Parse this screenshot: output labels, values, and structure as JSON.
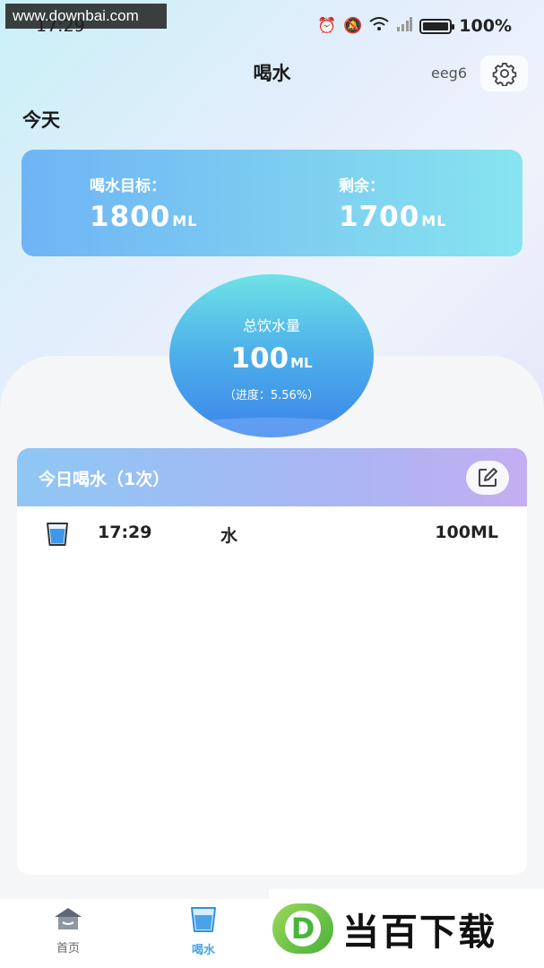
{
  "watermark_top": "www.downbai.com",
  "status_bar": {
    "time": "17:29",
    "battery": "100%"
  },
  "header": {
    "title": "喝水",
    "username": "eeg6"
  },
  "today_label": "今天",
  "target_card": {
    "goal_label": "喝水目标：",
    "goal_value": "1800",
    "remaining_label": "剩余：",
    "remaining_value": "1700",
    "unit": "ML"
  },
  "total_circle": {
    "label": "总饮水量",
    "value": "100",
    "unit": "ML",
    "progress_text": "（进度：5.56%）"
  },
  "records": {
    "title": "今日喝水（1次）",
    "items": [
      {
        "time": "17:29",
        "type": "水",
        "amount": "100ML"
      }
    ]
  },
  "bottom_nav": {
    "items": [
      {
        "label": "首页",
        "icon": "home-icon"
      },
      {
        "label": "喝水",
        "icon": "cup-icon"
      },
      {
        "label": "",
        "icon": "stats-icon"
      },
      {
        "label": "",
        "icon": "user-icon"
      }
    ],
    "active_index": 1
  },
  "watermark_bottom": {
    "logo_letter": "D",
    "text": "当百下载"
  },
  "colors": {
    "accent": "#4aa3ea",
    "card_start": "#6fb4f5",
    "card_end": "#86e4ef"
  }
}
